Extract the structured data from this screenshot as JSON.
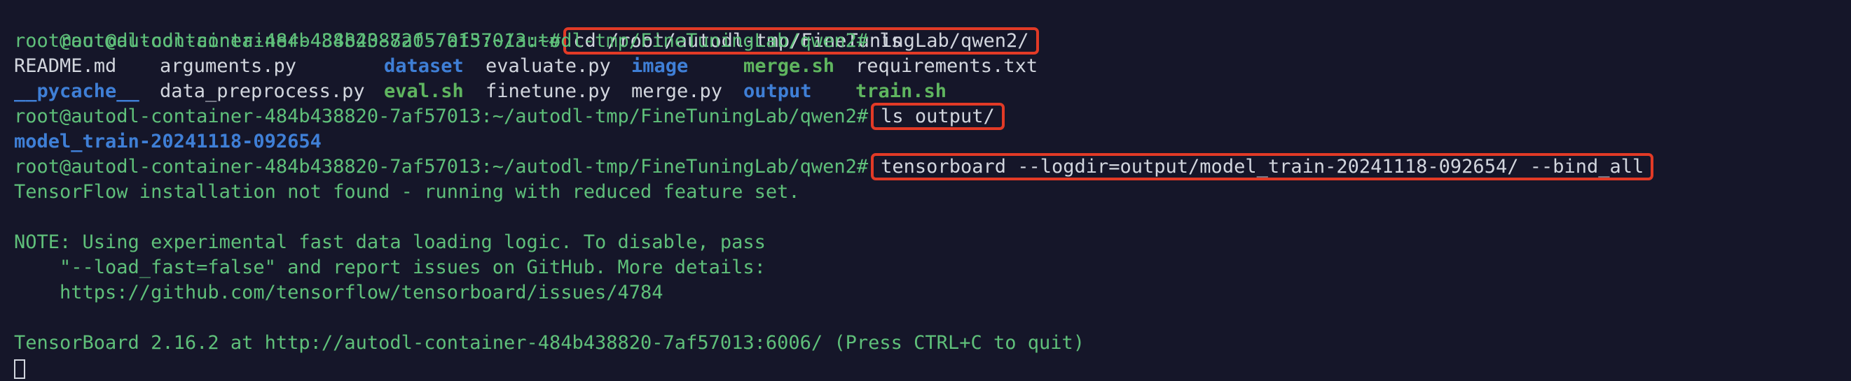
{
  "prompt": "root@autodl-container-484b438820-7af57013:~/autodl-tmp/FineTuningLab/qwen2#",
  "prompt_home": "root@autodl-container-484b438820-7af57013:~#",
  "commands": {
    "cd": "cd /root/autodl-tmp/FineTuningLab/qwen2/",
    "ls": " ls",
    "ls_output": "ls output/",
    "tensorboard": "tensorboard --logdir=output/model_train-20241118-092654/ --bind_all"
  },
  "ls_listing": {
    "row1": [
      "README.md",
      "arguments.py",
      "dataset",
      "evaluate.py",
      "image",
      "merge.sh",
      "requirements.txt"
    ],
    "row2": [
      "__pycache__",
      "data_preprocess.py",
      "eval.sh",
      "finetune.py",
      "merge.py",
      "output",
      "train.sh"
    ]
  },
  "output_dir": "model_train-20241118-092654",
  "messages": {
    "tf_missing": "TensorFlow installation not found - running with reduced feature set.",
    "note1": "NOTE: Using experimental fast data loading logic. To disable, pass",
    "note2": "    \"--load_fast=false\" and report issues on GitHub. More details:",
    "note3": "    https://github.com/tensorflow/tensorboard/issues/4784",
    "running": "TensorBoard 2.16.2 at http://autodl-container-484b438820-7af57013:6006/ (Press CTRL+C to quit)"
  },
  "colors": {
    "background": "#151629",
    "text": "#d2d6de",
    "directory": "#3f7fd6",
    "executable": "#5fb55f",
    "info_text": "#5fc07a",
    "highlight_box": "#e23a26"
  }
}
